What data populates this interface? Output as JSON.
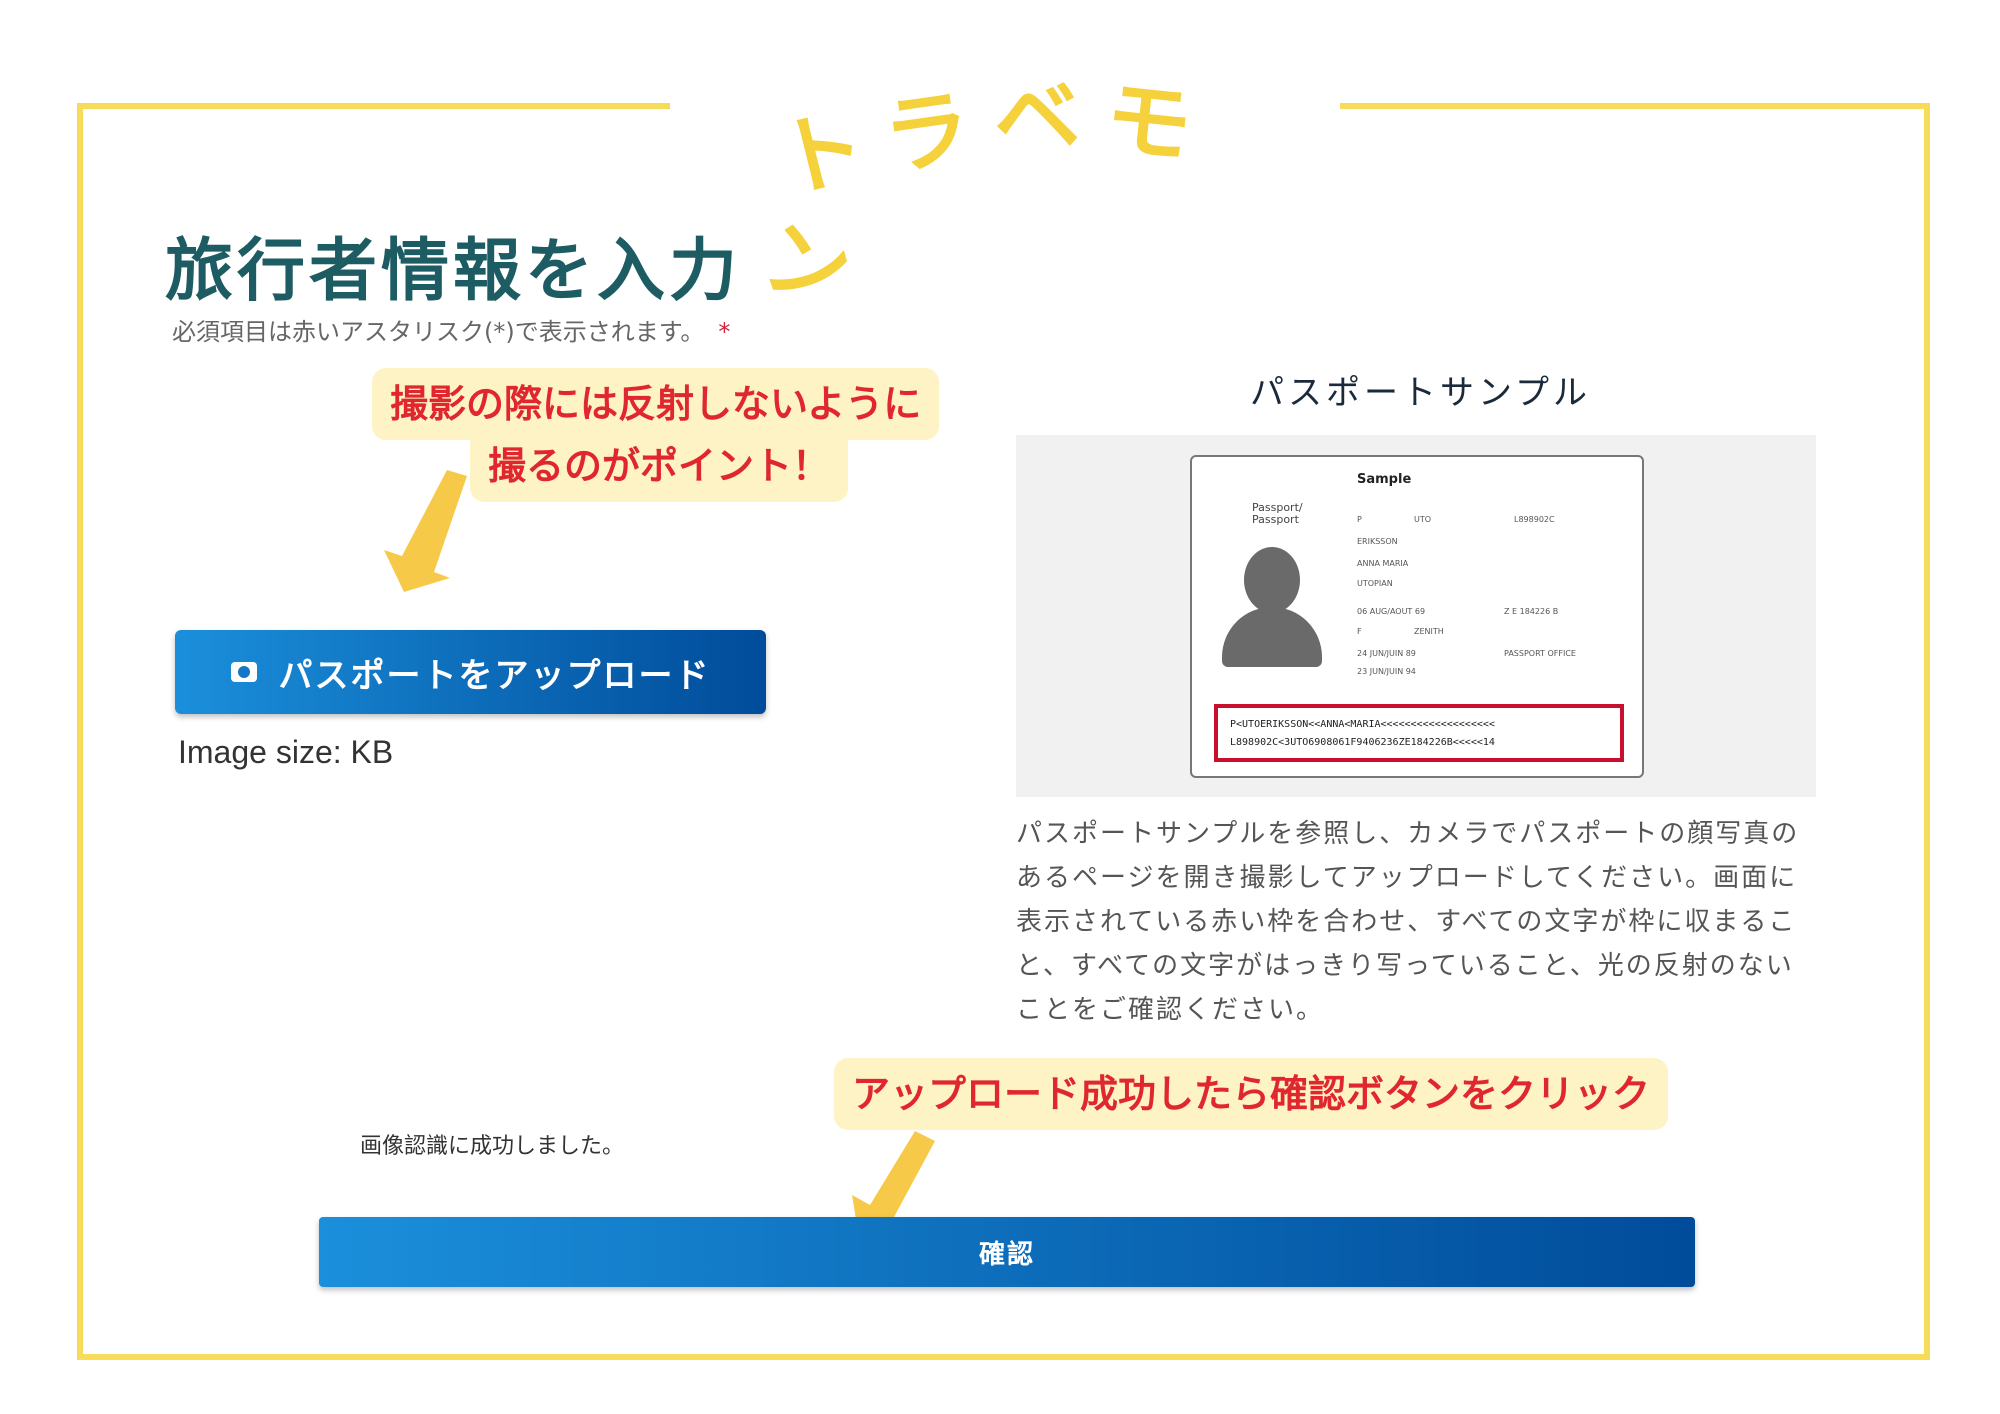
{
  "brand": {
    "chars": [
      "ト",
      "ラ",
      "ベ",
      "モ",
      "ン"
    ]
  },
  "form": {
    "title": "旅行者情報を入力",
    "required_note": "必須項目は赤いアスタリスク(*)で表示されます。",
    "required_asterisk": "*",
    "upload_button": "パスポートをアップロード",
    "image_size": "Image size: KB",
    "success_message": "画像認識に成功しました。",
    "confirm_button": "確認"
  },
  "callouts": {
    "tip_line1": "撮影の際には反射しないように",
    "tip_line2": "撮るのがポイント！",
    "confirm_tip": "アップロード成功したら確認ボタンをクリック"
  },
  "sample": {
    "title": "パスポートサンプル",
    "description": "パスポートサンプルを参照し、カメラでパスポートの顔写真のあるページを開き撮影してアップロードしてください。画面に表示されている赤い枠を合わせ、すべての文字が枠に収まること、すべての文字がはっきり写っていること、光の反射のないことをご確認ください。",
    "passport": {
      "heading": "Sample",
      "label": "Passport/\nPassport",
      "fields": [
        "P",
        "UTO",
        "L898902C",
        "ERIKSSON",
        "ANNA MARIA",
        "UTOPIAN",
        "06 AUG/AOUT 69",
        "Z E 184226 B",
        "F",
        "ZENITH",
        "24 JUN/JUIN 89",
        "PASSPORT OFFICE",
        "23 JUN/JUIN 94"
      ],
      "mrz_line1": "P<UTOERIKSSON<<ANNA<MARIA<<<<<<<<<<<<<<<<<<<",
      "mrz_line2": "L898902C<3UTO6908061F9406236ZE184226B<<<<<14"
    }
  },
  "colors": {
    "frame": "#f7dc5a",
    "brand": "#f5d23c",
    "title": "#1d5c63",
    "callout_bg": "#fdf3c4",
    "callout_text": "#e0262e",
    "button_start": "#1b8fdb",
    "button_end": "#004c9a",
    "arrow": "#f7c948"
  }
}
